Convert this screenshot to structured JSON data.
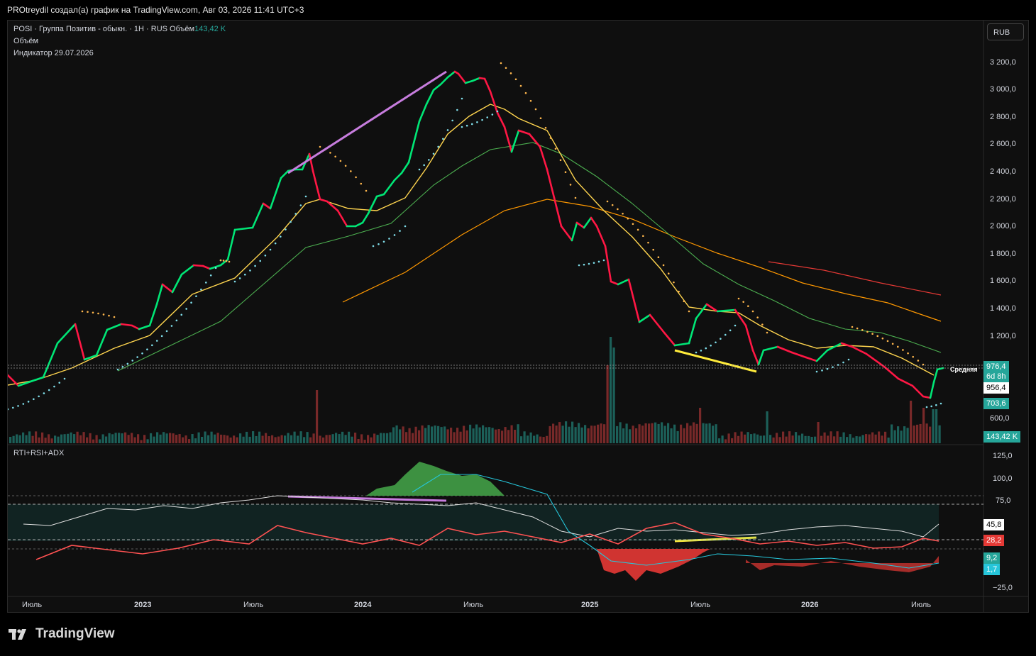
{
  "header": {
    "title": "PROtreydil создал(а) график на TradingView.com, Авг 03, 2026 11:41 UTC+3"
  },
  "legend": {
    "symbol": "POSI · Группа Позитив - обыкн. · 1H · RUS",
    "volume_label": "Объём",
    "volume_value": "143,42 K",
    "volume_line": "Объём",
    "indicator_line": "Индикатор 29.07.2026",
    "lower_pane": "RTI+RSI+ADX"
  },
  "currency_button": "RUB",
  "colors": {
    "up": "#00e676",
    "down": "#ff1744",
    "ema_fast": "#ffd54f",
    "ema_slow": "#4caf50",
    "ema_orange": "#ff9800",
    "ema_red": "#e53935",
    "trend_purple": "#c77dde",
    "trend_yellow": "#ffeb3b",
    "psar": "#80deea",
    "rsi": "#e0e0e0",
    "rti": "#ff5252"
  },
  "price_axis": {
    "ticks": [
      "3 200,0",
      "3 000,0",
      "2 800,0",
      "2 600,0",
      "2 400,0",
      "2 200,0",
      "2 000,0",
      "1 800,0",
      "1 600,0",
      "1 400,0",
      "1 200,0",
      "600,0"
    ]
  },
  "price_tags": {
    "current": "976,4",
    "countdown": "6d 8h",
    "avg": "956,4",
    "avg_label": "Средняя",
    "psar": "703,6",
    "volume": "143,42 K"
  },
  "osc_axis": {
    "ticks": [
      "125,0",
      "100,0",
      "75,0",
      "−25,0"
    ]
  },
  "osc_tags": {
    "rsi": "45,8",
    "rti": "28,2",
    "adx_plus": "9,2",
    "adx_minus": "1,7"
  },
  "time_axis": {
    "labels": [
      "Июль",
      "2023",
      "Июль",
      "2024",
      "Июль",
      "2025",
      "Июль",
      "2026",
      "Июль"
    ]
  },
  "footer": {
    "brand": "TradingView"
  }
}
